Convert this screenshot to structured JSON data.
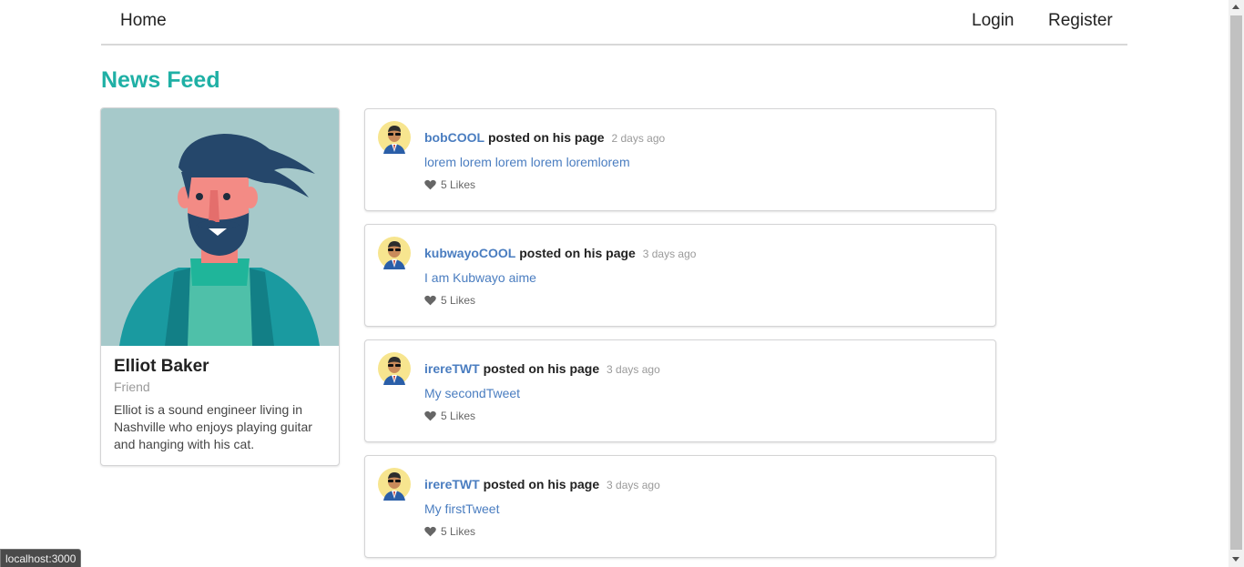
{
  "nav": {
    "home": "Home",
    "login": "Login",
    "register": "Register"
  },
  "page_title": "News Feed",
  "profile": {
    "name": "Elliot Baker",
    "meta": "Friend",
    "description": "Elliot is a sound engineer living in Nashville who enjoys playing guitar and hanging with his cat."
  },
  "posts": [
    {
      "author": "bobCOOL",
      "action": "posted on his page",
      "date": "2 days ago",
      "text": "lorem lorem lorem lorem loremlorem",
      "likes": "5 Likes"
    },
    {
      "author": "kubwayoCOOL",
      "action": "posted on his page",
      "date": "3 days ago",
      "text": "I am Kubwayo aime",
      "likes": "5 Likes"
    },
    {
      "author": "irereTWT",
      "action": "posted on his page",
      "date": "3 days ago",
      "text": "My secondTweet",
      "likes": "5 Likes"
    },
    {
      "author": "irereTWT",
      "action": "posted on his page",
      "date": "3 days ago",
      "text": "My firstTweet",
      "likes": "5 Likes"
    }
  ],
  "status_bar": "localhost:3000",
  "colors": {
    "accent": "#1fb0a5",
    "link": "#4a7dc0",
    "card_bg": "#a6c9ca"
  },
  "icons": {
    "like": "heart-icon",
    "avatar": "avatar-icon"
  }
}
